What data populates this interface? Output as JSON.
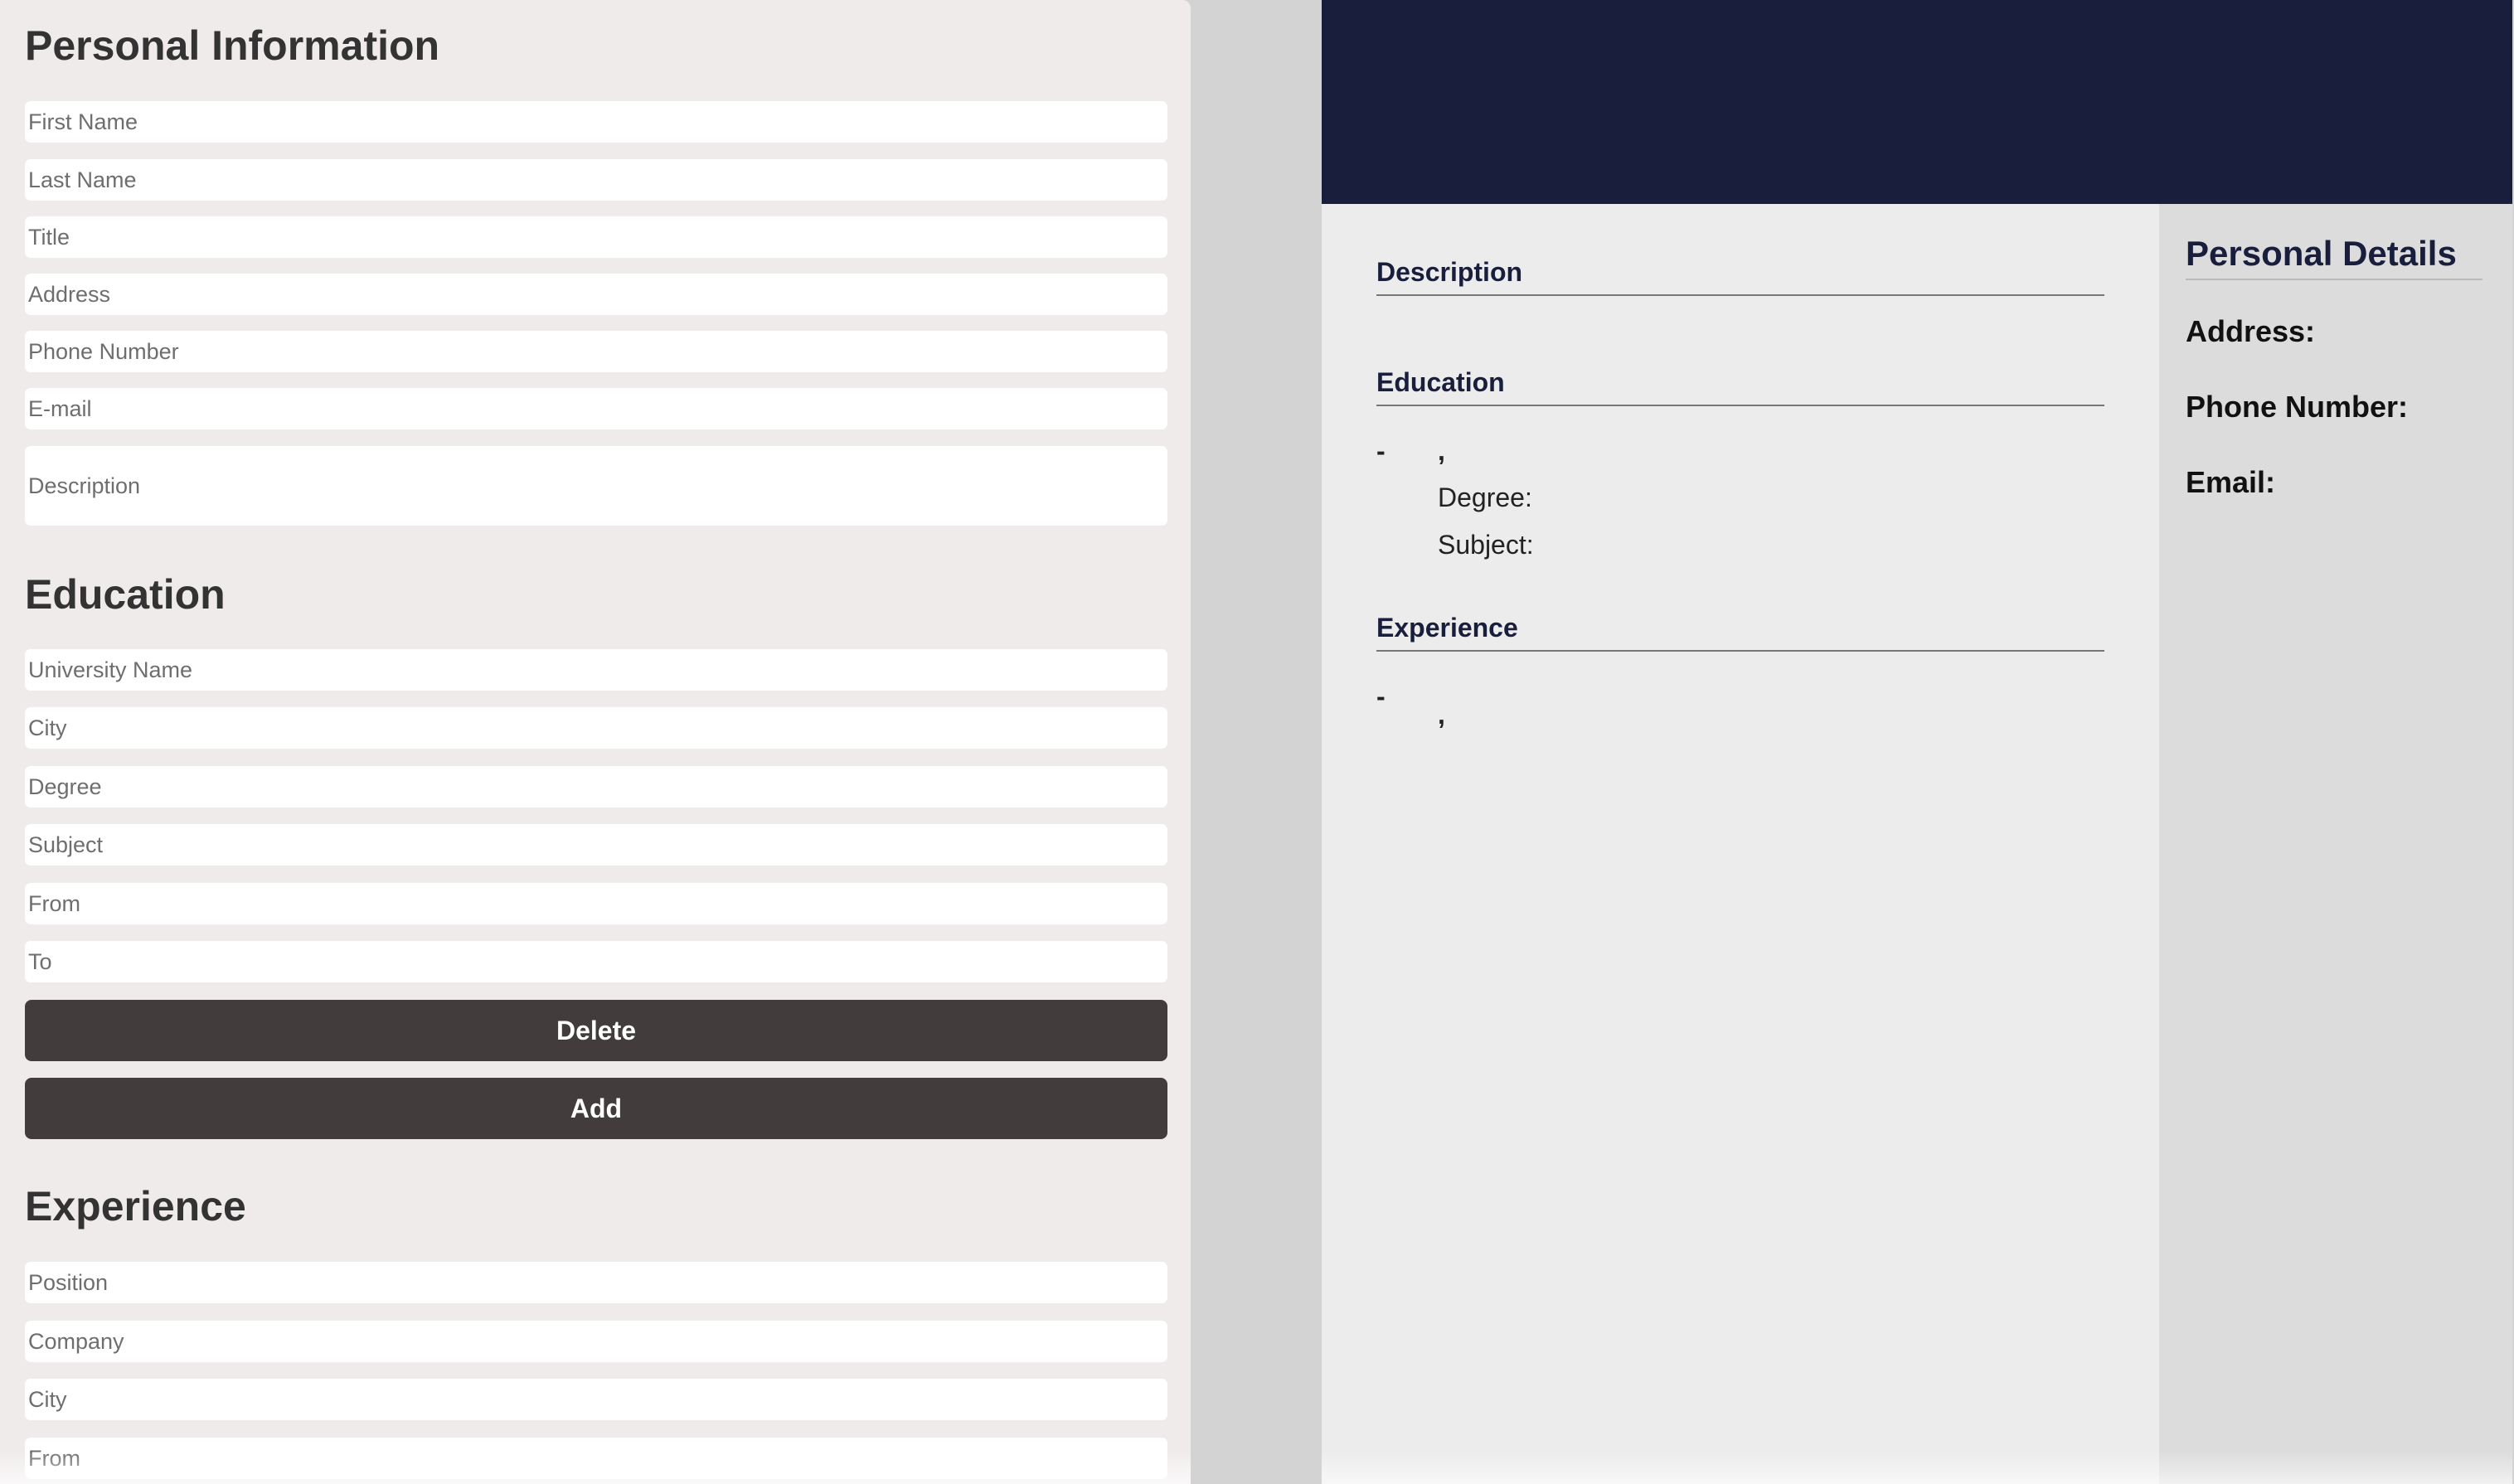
{
  "editor": {
    "personal": {
      "heading": "Personal Information",
      "fields": {
        "first_name": "First Name",
        "last_name": "Last Name",
        "title": "Title",
        "address": "Address",
        "phone": "Phone Number",
        "email": "E-mail",
        "description": "Description"
      }
    },
    "education": {
      "heading": "Education",
      "fields": {
        "university": "University Name",
        "city": "City",
        "degree": "Degree",
        "subject": "Subject",
        "from": "From",
        "to": "To"
      },
      "delete_label": "Delete",
      "add_label": "Add"
    },
    "experience": {
      "heading": "Experience",
      "fields": {
        "position": "Position",
        "company": "Company",
        "city": "City",
        "from": "From"
      }
    }
  },
  "preview": {
    "description_title": "Description",
    "education_title": "Education",
    "education_entry": {
      "dash": "-",
      "separator": ",",
      "degree_label": "Degree:",
      "subject_label": "Subject:"
    },
    "experience_title": "Experience",
    "experience_entry": {
      "dash": "-",
      "separator": ","
    },
    "side": {
      "title": "Personal Details",
      "address_label": "Address:",
      "phone_label": "Phone Number:",
      "email_label": "Email:"
    }
  },
  "colors": {
    "header_navy": "#181e3c",
    "button_dark": "#423d3c",
    "editor_bg": "#f0ebeb"
  }
}
